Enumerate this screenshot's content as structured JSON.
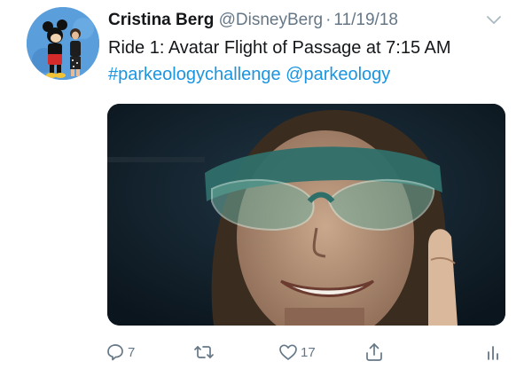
{
  "tweet": {
    "author": {
      "display_name": "Cristina Berg",
      "handle": "@DisneyBerg",
      "separator": "·",
      "date": "11/19/18"
    },
    "text": {
      "line1": "Ride 1: Avatar Flight of Passage at 7:15 AM",
      "hashtag": "#parkeologychallenge",
      "mention": "@parkeology"
    },
    "actions": {
      "reply_count": "7",
      "retweet_count": "",
      "like_count": "17"
    },
    "icons": {
      "reply": "reply-icon",
      "retweet": "retweet-icon",
      "like": "heart-icon",
      "share": "share-icon",
      "analytics": "analytics-icon",
      "menu": "chevron-down-icon"
    },
    "colors": {
      "link": "#1b95e0",
      "secondary_text": "#657786",
      "primary_text": "#14171a"
    }
  }
}
